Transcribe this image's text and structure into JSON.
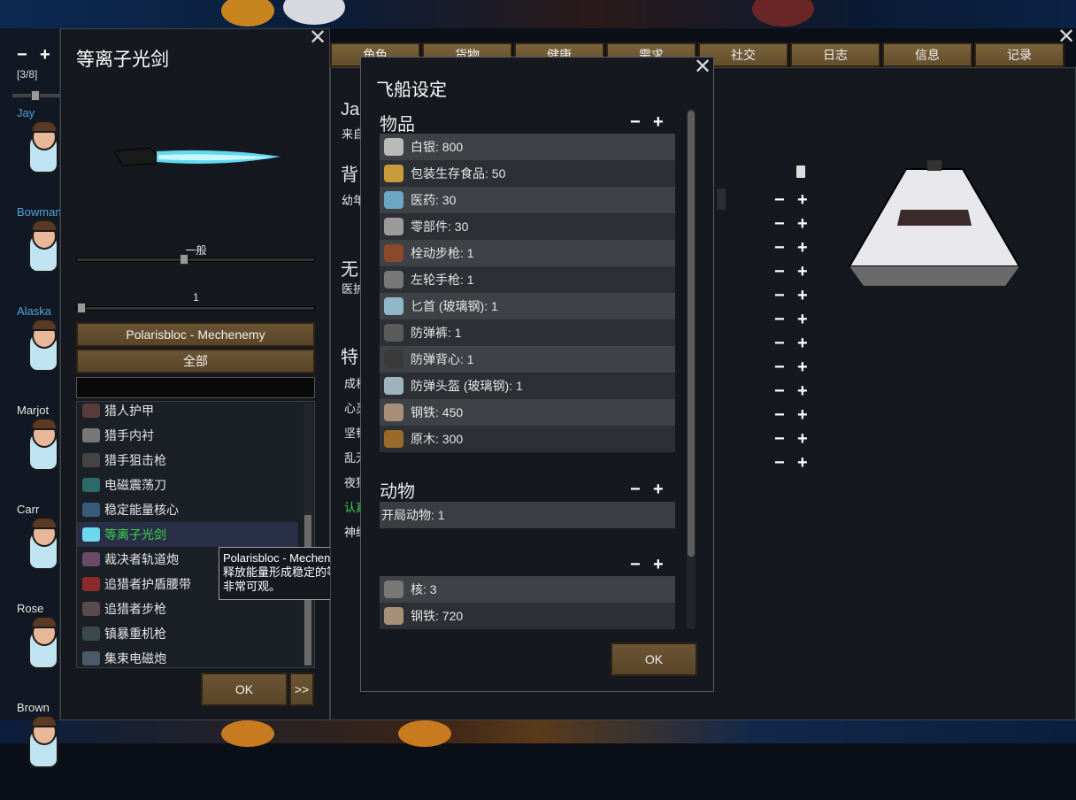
{
  "strip": {
    "minus": "−",
    "plus": "+",
    "count": "[3/8]"
  },
  "colonists": [
    {
      "name": "Jay",
      "color": "#4fa3d6"
    },
    {
      "name": "Bowman",
      "color": "#4fa3d6"
    },
    {
      "name": "Alaska",
      "color": "#4fa3d6"
    },
    {
      "name": "Marjot",
      "color": "#e6e6e6"
    },
    {
      "name": "Carr",
      "color": "#e6e6e6"
    },
    {
      "name": "Rose",
      "color": "#e6e6e6"
    },
    {
      "name": "Brown",
      "color": "#e6e6e6"
    }
  ],
  "item_panel": {
    "title": "等离子光剑",
    "quality_label": "一般",
    "quality_level": 0.45,
    "count_label": "1",
    "mod_button": "Polarisbloc - Mechenemy",
    "filter_button": "全部",
    "search_value": "",
    "items": [
      {
        "label": "猎人护甲",
        "icon": "hunter-armor-icon",
        "selected": false
      },
      {
        "label": "猎手内衬",
        "icon": "hunter-liner-icon",
        "selected": false
      },
      {
        "label": "猎手狙击枪",
        "icon": "sniper-rifle-icon",
        "selected": false
      },
      {
        "label": "电磁震荡刀",
        "icon": "em-blade-icon",
        "selected": false
      },
      {
        "label": "稳定能量核心",
        "icon": "energy-core-icon",
        "selected": false
      },
      {
        "label": "等离子光剑",
        "icon": "plasma-sword-icon",
        "selected": true
      },
      {
        "label": "裁决者轨道炮",
        "icon": "railgun-icon",
        "selected": false
      },
      {
        "label": "追猎者护盾腰带",
        "icon": "shield-belt-icon",
        "selected": false
      },
      {
        "label": "追猎者步枪",
        "icon": "rifle-icon",
        "selected": false
      },
      {
        "label": "镇暴重机枪",
        "icon": "heavy-mg-icon",
        "selected": false
      },
      {
        "label": "集束电磁炮",
        "icon": "em-cannon-icon",
        "selected": false
      }
    ],
    "ok_button": "OK",
    "next_button": ">>"
  },
  "tooltip": {
    "title": "Polarisbloc - Mechenemy",
    "desc_line1": "释放能量形成稳定的等离子体剑刃，伤害",
    "desc_line2": "非常可观。"
  },
  "tabs": [
    "角色",
    "货物",
    "健康",
    "需求",
    "社交",
    "日志",
    "信息",
    "记录"
  ],
  "char_panel": {
    "name_partial": "Ja",
    "origin_partial": "来自",
    "backstory_head": "背",
    "childhood_partial": "幼年",
    "none_head": "无",
    "medical_partial": "医护",
    "traits_head": "特",
    "trait_lines": [
      "成相",
      "心灵",
      "坚韧",
      "乱无",
      "夜猫",
      "认真",
      "神经"
    ]
  },
  "ship_dialog": {
    "title": "飞船设定",
    "items_head": "物品",
    "items": [
      {
        "label": "白银: 800",
        "icon": "silver-icon",
        "color": "#b9b9b9"
      },
      {
        "label": "包装生存食品: 50",
        "icon": "survival-meal-icon",
        "color": "#c99a3a"
      },
      {
        "label": "医药: 30",
        "icon": "medicine-icon",
        "color": "#6aa7c4"
      },
      {
        "label": "零部件: 30",
        "icon": "components-icon",
        "color": "#9a9a9a"
      },
      {
        "label": "栓动步枪: 1",
        "icon": "bolt-rifle-icon",
        "color": "#8a4a2a"
      },
      {
        "label": "左轮手枪: 1",
        "icon": "revolver-icon",
        "color": "#777777"
      },
      {
        "label": "匕首 (玻璃钢): 1",
        "icon": "knife-icon",
        "color": "#8fb7c7"
      },
      {
        "label": "防弹裤: 1",
        "icon": "flak-pants-icon",
        "color": "#5a5a5a"
      },
      {
        "label": "防弹背心: 1",
        "icon": "flak-vest-icon",
        "color": "#3a3a3a"
      },
      {
        "label": "防弹头盔 (玻璃钢): 1",
        "icon": "helmet-icon",
        "color": "#9fb3bf"
      },
      {
        "label": "钢铁: 450",
        "icon": "steel-icon",
        "color": "#a88f78"
      },
      {
        "label": "原木: 300",
        "icon": "wood-icon",
        "color": "#9a6a2a"
      }
    ],
    "animals_head": "动物",
    "animals": [
      {
        "label": "开局动物: 1"
      }
    ],
    "scatter": [
      {
        "label": "核: 3",
        "icon": "core-icon",
        "color": "#777777"
      },
      {
        "label": "钢铁: 720",
        "icon": "steel-icon",
        "color": "#a88f78"
      }
    ],
    "ok_button": "OK"
  }
}
